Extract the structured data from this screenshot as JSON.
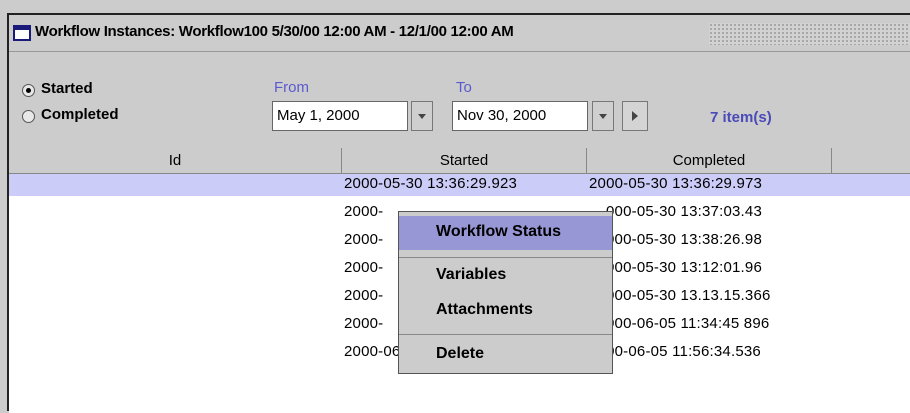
{
  "window": {
    "title": "Workflow Instances: Workflow100 5/30/00 12:00 AM - 12/1/00 12:00 AM"
  },
  "filter": {
    "started_label": "Started",
    "completed_label": "Completed",
    "selected": "Started",
    "from_label": "From",
    "to_label": "To",
    "from_date": "May 1, 2000",
    "to_date": "Nov 30, 2000",
    "item_count": "7  item(s)"
  },
  "table": {
    "columns": [
      "Id",
      "Started",
      "Completed"
    ],
    "rows": [
      {
        "id": "",
        "started": "2000-05-30 13:36:29.923",
        "completed": "2000-05-30 13:36:29.973"
      },
      {
        "id": "",
        "started": "2000-",
        "completed": "000-05-30 13:37:03.43"
      },
      {
        "id": "",
        "started": "2000-",
        "completed": "000-05-30 13:38:26.98"
      },
      {
        "id": "",
        "started": "2000-",
        "completed": "000-05-30 13:12:01.96"
      },
      {
        "id": "",
        "started": "2000-",
        "completed": "000-05-30 13.13.15.366"
      },
      {
        "id": "",
        "started": "2000-",
        "completed": "000-06-05 11:34:45 896"
      },
      {
        "id": "",
        "started": "2000-06-05 11 56:34.436",
        "completed": "2000-06-05 11:56:34.536"
      }
    ]
  },
  "context_menu": {
    "items": [
      "Workflow Status",
      "Variables",
      "Attachments",
      "Delete"
    ],
    "highlighted": "Workflow Status"
  },
  "colors": {
    "selection": "#ccccf8",
    "menu_highlight": "#9797d6",
    "label_blue": "#5a5acf"
  }
}
